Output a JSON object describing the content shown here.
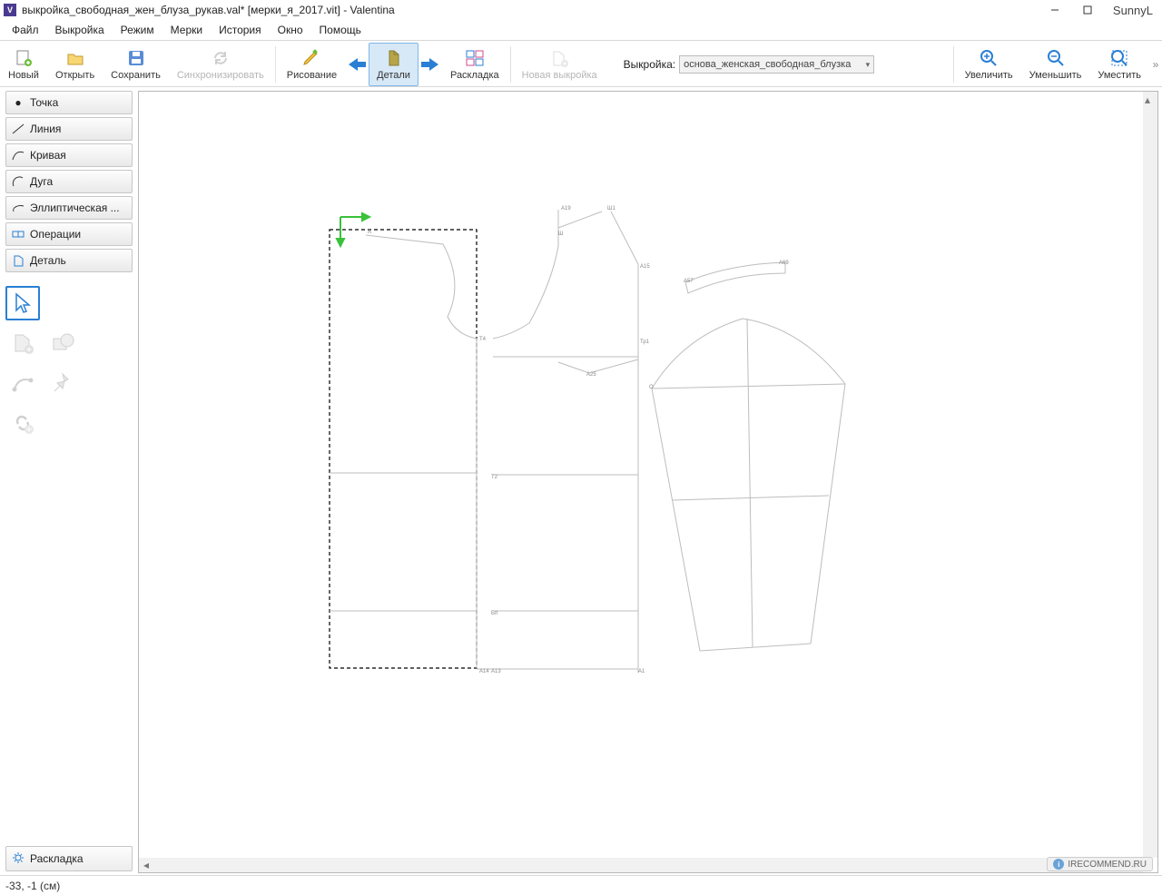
{
  "title": "выкройка_свободная_жен_блуза_рукав.val* [мерки_я_2017.vit] - Valentina",
  "user": "SunnyL",
  "menus": [
    "Файл",
    "Выкройка",
    "Режим",
    "Мерки",
    "История",
    "Окно",
    "Помощь"
  ],
  "toolbar": {
    "new": "Новый",
    "open": "Открыть",
    "save": "Сохранить",
    "sync": "Синхронизировать",
    "draw": "Рисование",
    "details": "Детали",
    "layout": "Раскладка",
    "newpattern": "Новая выкройка",
    "pattern_label": "Выкройка:",
    "pattern_value": "основа_женская_свободная_блузка",
    "zoomin": "Увеличить",
    "zoomout": "Уменьшить",
    "fit": "Уместить"
  },
  "side_tools": [
    "Точка",
    "Линия",
    "Кривая",
    "Дуга",
    "Эллиптическая ...",
    "Операции",
    "Деталь"
  ],
  "side_bottom": "Раскладка",
  "status": "-33, -1 (см)",
  "watermark": "IRECOMMEND.RU",
  "canvas_point_labels": [
    "А19",
    "Ш1",
    "Ш",
    "А15",
    "А69",
    "А57",
    "Тр1",
    "Т4",
    "А25",
    "Т2",
    "А14",
    "А13",
    "А1",
    "Бп",
    "О",
    "А"
  ]
}
